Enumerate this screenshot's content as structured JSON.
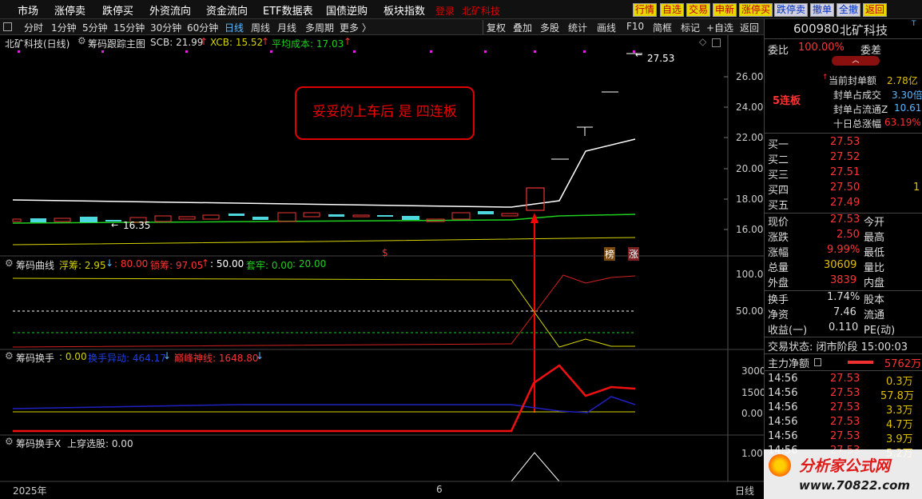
{
  "menu": {
    "items": [
      "市场",
      "涨停卖",
      "跌停买",
      "外资流向",
      "资金流向",
      "ETF数据表",
      "国债逆购",
      "板块指数"
    ],
    "login": "登录",
    "stock_title": "北矿科技",
    "buttons": [
      "行情",
      "自选",
      "交易",
      "申新",
      "涨停买",
      "跌停卖",
      "撤单",
      "全撤",
      "返回"
    ]
  },
  "toolbar": {
    "periods": [
      "分时",
      "1分钟",
      "5分钟",
      "15分钟",
      "30分钟",
      "60分钟",
      "日线",
      "周线",
      "月线",
      "多周期",
      "更多 〉"
    ],
    "selected": "日线",
    "actions": [
      "复权",
      "叠加",
      "多股",
      "统计",
      "画线",
      "F10",
      "简框",
      "标记",
      "+自选",
      "返回"
    ]
  },
  "main": {
    "title": "北矿科技(日线)",
    "indicator": "筹码跟踪主图",
    "scb": "SCB: 21.99",
    "xcb": "XCB: 15.52",
    "avg": "平均成本: 17.03",
    "yticks": [
      "26.00",
      "24.00",
      "22.00",
      "20.00",
      "18.00",
      "16.00"
    ],
    "high_label": "27.53",
    "low_label": "16.35",
    "annotation": "妥妥的上车后 是 四连板",
    "marker_s": "$",
    "marker_bang": "榜",
    "marker_zhang": "涨"
  },
  "p2": {
    "title": "筹码曲线",
    "fuchou": "浮筹: 2.95",
    "v1": ": 80.00",
    "suochou": "锁筹: 97.05",
    "v2": ": 50.00",
    "taolao": "套牢: 0.00",
    "v3": ": 20.00",
    "yticks": [
      "100.0",
      "50.00"
    ]
  },
  "p3": {
    "title": "筹码换手",
    "v0": ": 0.00",
    "yidong": "换手异动: 464.17",
    "dianfeng": "巅峰神线: 1648.80",
    "yticks": [
      "3000",
      "1500",
      "0.00"
    ]
  },
  "p4": {
    "title": "筹码换手X",
    "shangchuan": "上穿选股: 0.00",
    "ytick": "1.00"
  },
  "xaxis": {
    "year": "2025年",
    "month": "6",
    "period": "日线"
  },
  "quote": {
    "code": "600980",
    "name": "北矿科技",
    "weibi_label": "委比",
    "weibi": "100.00%",
    "weicha_label": "委差",
    "lianban": "5连板",
    "stats": [
      {
        "k": "当前封单额",
        "v": "2.78亿",
        "c": "#e0c000"
      },
      {
        "k": "封单占成交",
        "v": "3.30倍",
        "c": "#5cb8ff"
      },
      {
        "k": "封单占流通Z",
        "v": "10.61",
        "c": "#5cb8ff"
      },
      {
        "k": "十日总涨幅",
        "v": "63.19%",
        "c": "#ff3030"
      }
    ],
    "bids": [
      {
        "k": "买一",
        "v": "27.53"
      },
      {
        "k": "买二",
        "v": "27.52"
      },
      {
        "k": "买三",
        "v": "27.51"
      },
      {
        "k": "买四",
        "v": "27.50",
        "q": "1"
      },
      {
        "k": "买五",
        "v": "27.49"
      }
    ],
    "xianjia": "现价",
    "xianjia_v": "27.53",
    "jinkai": "今开",
    "zhangdie": "涨跌",
    "zhangdie_v": "2.50",
    "zuigao": "最高",
    "zhangfu": "涨幅",
    "zhangfu_v": "9.99%",
    "zuidi": "最低",
    "zongliang": "总量",
    "zongliang_v": "30609",
    "liangbi": "量比",
    "waipan": "外盘",
    "waipan_v": "3839",
    "neipan": "内盘",
    "huanshou": "换手",
    "huanshou_v": "1.74%",
    "guben": "股本",
    "jingzi": "净资",
    "jingzi_v": "7.46",
    "liutong": "流通",
    "shouyi": "收益(一)",
    "shouyi_v": "0.110",
    "pe": "PE(动)",
    "status": "交易状态: 闭市阶段 15:00:03",
    "zhuli": "主力净额",
    "zhuli_v": "5762万",
    "ticks": [
      {
        "t": "14:56",
        "p": "27.53",
        "v": "0.3万"
      },
      {
        "t": "14:56",
        "p": "27.53",
        "v": "57.8万"
      },
      {
        "t": "14:56",
        "p": "27.53",
        "v": "3.3万"
      },
      {
        "t": "14:56",
        "p": "27.53",
        "v": "4.7万"
      },
      {
        "t": "14:56",
        "p": "27.53",
        "v": "3.9万"
      },
      {
        "t": "14:56",
        "p": "27.53",
        "v": "5.2万"
      }
    ]
  },
  "watermark": {
    "title": "分析家公式网",
    "url": "www.70822.com"
  }
}
